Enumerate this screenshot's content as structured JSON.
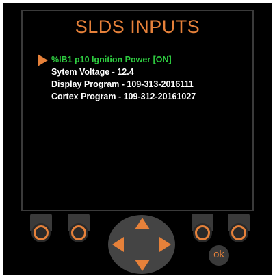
{
  "screen": {
    "title": "SLDS INPUTS",
    "items": [
      {
        "label": "%IB1 p10 Ignition Power [ON]"
      },
      {
        "label": "Sytem Voltage - 12.4"
      },
      {
        "label": "Display Program - 109-313-2016111"
      },
      {
        "label": "Cortex Program - 109-312-20161027"
      }
    ],
    "selected_index": 0
  },
  "controls": {
    "ok_label": "ok"
  },
  "colors": {
    "accent": "#e6813a",
    "selected_text": "#2ecc40",
    "text": "#ffffff",
    "background": "#000000"
  },
  "icons": {
    "cursor": "triangle-right-icon",
    "dpad_up": "arrow-up-icon",
    "dpad_down": "arrow-down-icon",
    "dpad_left": "arrow-left-icon",
    "dpad_right": "arrow-right-icon"
  }
}
